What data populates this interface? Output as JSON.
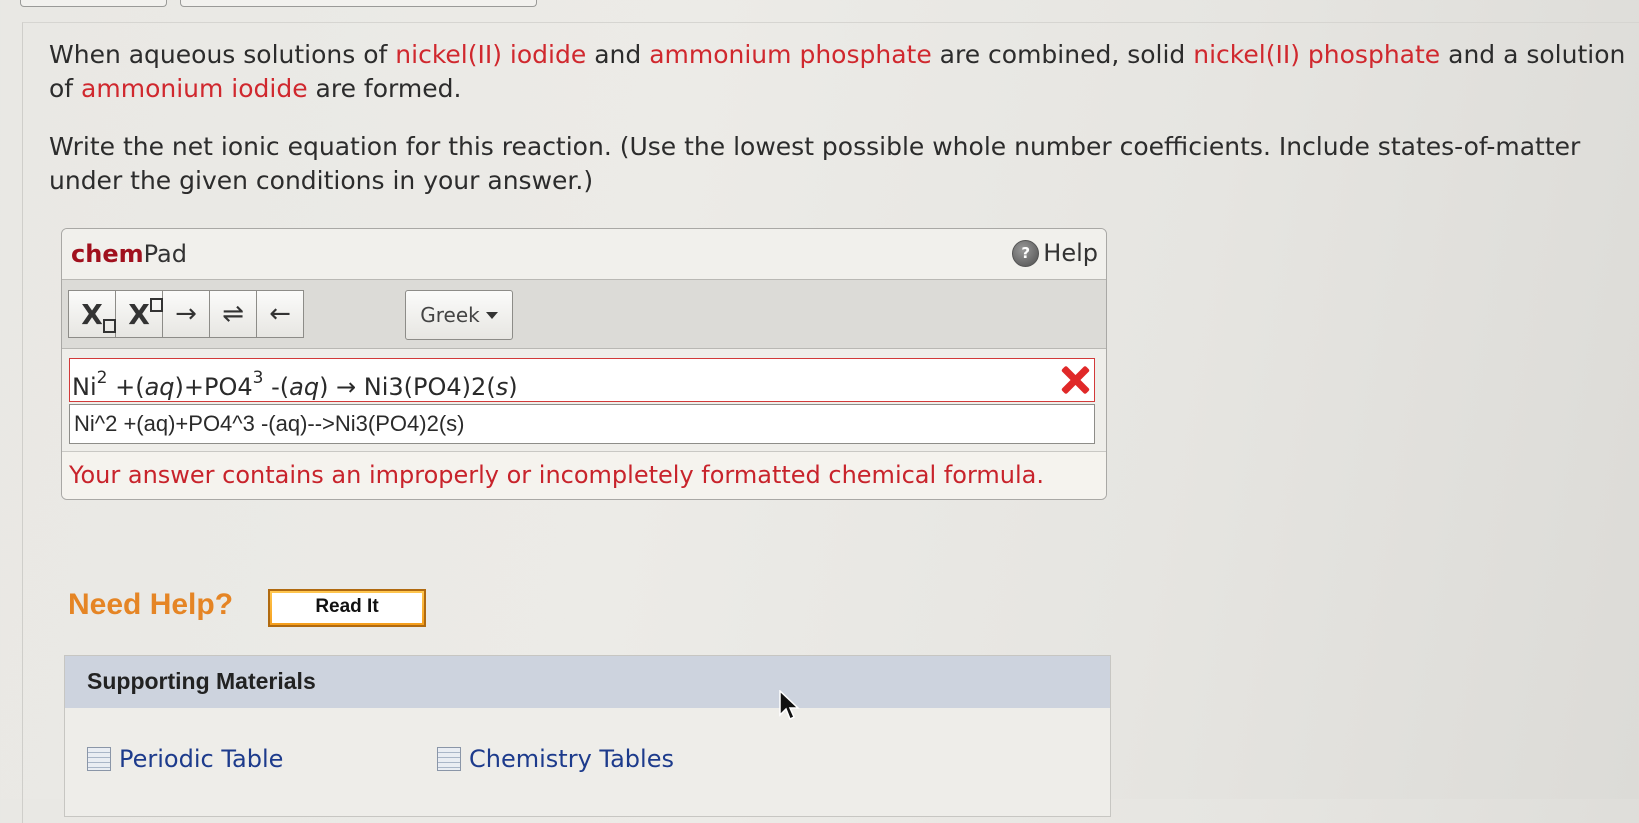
{
  "question": {
    "p1_a": "When aqueous solutions of ",
    "p1_reactant1": "nickel(II) iodide",
    "p1_b": " and ",
    "p1_reactant2": "ammonium phosphate",
    "p1_c": " are combined, solid ",
    "p1_product1": "nickel(II) phosphate",
    "p1_d": " and a solution of ",
    "p1_product2": "ammonium iodide",
    "p1_e": " are formed.",
    "p2": "Write the net ionic equation for this reaction. (Use the lowest possible whole number coefficients. Include states-of-matter under the given conditions in your answer.)"
  },
  "chempad": {
    "title_bold": "chem",
    "title_rest": "Pad",
    "help_label": "Help",
    "help_icon_glyph": "?",
    "toolbar": {
      "subscript_label": "X",
      "superscript_label": "X",
      "arrow": "→",
      "equilibrium": "⇌",
      "back_arrow": "←",
      "greek_label": "Greek"
    },
    "rendered": {
      "ni": "Ni",
      "ni_charge": "2",
      "mid1": " +(",
      "aq1": "aq",
      "mid2": ")+PO4",
      "po4_charge": "3",
      "mid3": " -(",
      "aq2": "aq",
      "mid4": ") → Ni3(PO4)2(",
      "s": "s",
      "end": ")"
    },
    "raw_input": "Ni^2 +(aq)+PO4^3 -(aq)-->Ni3(PO4)2(s)",
    "error_message": "Your answer contains an improperly or incompletely formatted chemical formula."
  },
  "need_help": {
    "label": "Need Help?",
    "read_it": "Read It"
  },
  "supporting": {
    "header": "Supporting Materials",
    "links": [
      "Periodic Table",
      "Chemistry Tables"
    ]
  },
  "colors": {
    "highlight": "#d0282e",
    "error": "#c8232b",
    "need_help": "#e58525",
    "link": "#1d3b8c"
  }
}
